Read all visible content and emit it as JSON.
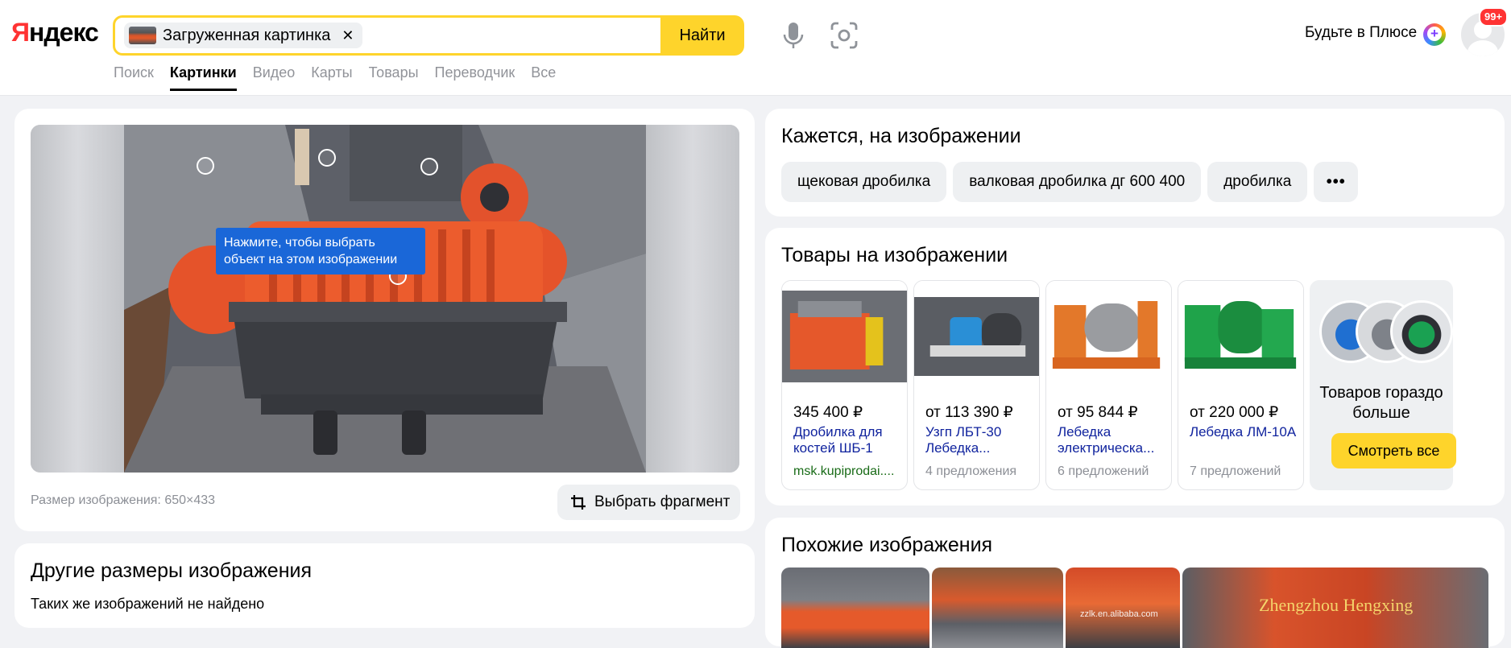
{
  "header": {
    "logo": "Яндекс",
    "search_chip_label": "Загруженная картинка",
    "search_chip_close": "✕",
    "find_button": "Найти",
    "plus_text": "Будьте в Плюсе",
    "notif_badge": "99+"
  },
  "tabs": [
    {
      "label": "Поиск",
      "active": false
    },
    {
      "label": "Картинки",
      "active": true
    },
    {
      "label": "Видео",
      "active": false
    },
    {
      "label": "Карты",
      "active": false
    },
    {
      "label": "Товары",
      "active": false
    },
    {
      "label": "Переводчик",
      "active": false
    },
    {
      "label": "Все",
      "active": false
    }
  ],
  "viewer": {
    "hint": "Нажмите, чтобы выбрать объект на этом изображении",
    "size_text": "Размер изображения: 650×433",
    "fragment_button": "Выбрать фрагмент"
  },
  "other_sizes": {
    "title": "Другие размеры изображения",
    "subtitle": "Таких же изображений не найдено"
  },
  "seems": {
    "title": "Кажется, на изображении",
    "tags": [
      "щековая дробилка",
      "валковая дробилка дг 600 400",
      "дробилка"
    ],
    "more_label": "•••"
  },
  "goods": {
    "title": "Товары на изображении",
    "items": [
      {
        "price": "345 400 ₽",
        "name": "Дробилка для костей ШБ-1",
        "meta": "msk.kupiprodai....",
        "meta_is_shop": true
      },
      {
        "price": "от 113 390 ₽",
        "name": "Узгп ЛБТ-30 Лебедка...",
        "meta": "4 предложения",
        "meta_is_shop": false
      },
      {
        "price": "от 95 844 ₽",
        "name": "Лебедка электрическа...",
        "meta": "6 предложений",
        "meta_is_shop": false
      },
      {
        "price": "от 220 000 ₽",
        "name": "Лебедка ЛМ-10А",
        "meta": "7 предложений",
        "meta_is_shop": false
      }
    ],
    "more_label": "Товаров гораздо больше",
    "more_button": "Смотреть все"
  },
  "similar": {
    "title": "Похожие изображения",
    "watermark_1": "zzlk.en.alibaba.com",
    "watermark_2": "Zhengzhou Hengxing"
  },
  "colors": {
    "accent_yellow": "#fed42b",
    "link_blue": "#10239e",
    "shop_green": "#196b17",
    "hint_blue": "#1a67d8",
    "logo_red": "#ff3333"
  }
}
